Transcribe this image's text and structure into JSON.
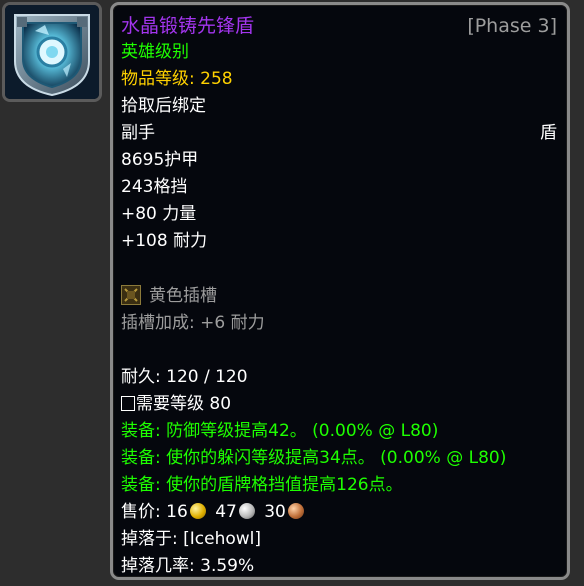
{
  "item": {
    "name": "水晶锻铸先锋盾",
    "phase": "[Phase 3]",
    "heroic": "英雄级别",
    "item_level_label": "物品等级:",
    "item_level_value": "258",
    "binding": "拾取后绑定",
    "slot": "副手",
    "type": "盾",
    "armor": "8695护甲",
    "block": "243格挡",
    "strength": "+80 力量",
    "stamina": "+108 耐力",
    "socket_label": "黄色插槽",
    "socket_bonus": "插槽加成: +6 耐力",
    "durability": "耐久: 120 / 120",
    "req_level": "需要等级 80",
    "equip_1": "装备: 防御等级提高42。 (0.00% @ L80)",
    "equip_2": "装备: 使你的躲闪等级提高34点。 (0.00% @ L80)",
    "equip_3": "装备:  使你的盾牌格挡值提高126点。",
    "sell_label": "售价:",
    "sell_gold": "16",
    "sell_silver": "47",
    "sell_copper": "30",
    "drop_from": "掉落于: [Icehowl]",
    "drop_rate": "掉落几率: 3.59%"
  },
  "icons": {
    "item_icon": "crystal-shield-icon",
    "socket_icon": "yellow-socket-icon",
    "gold_icon": "gold-coin-icon",
    "silver_icon": "silver-coin-icon",
    "copper_icon": "copper-coin-icon"
  },
  "colors": {
    "epic": "#a335ee",
    "heroic_green": "#1eff00",
    "gold_text": "#ffd100",
    "gray_text": "#9d9d9d",
    "tooltip_bg": "#05070d"
  }
}
